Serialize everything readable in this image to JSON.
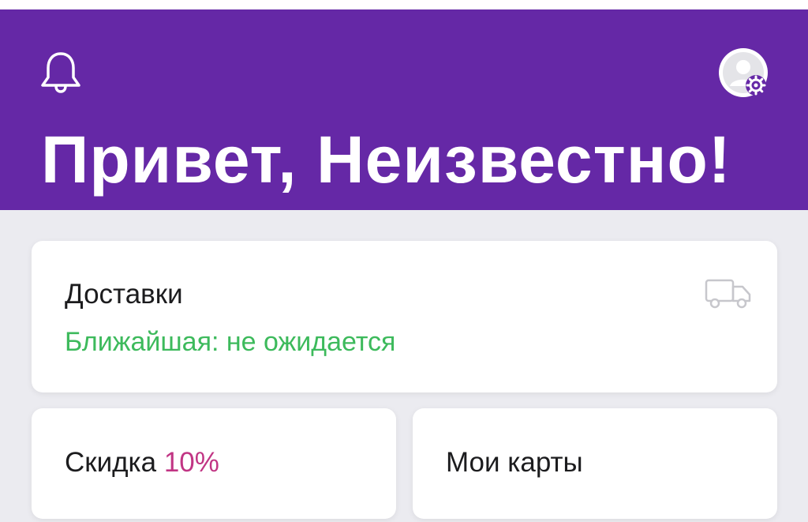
{
  "header": {
    "greeting": "Привет, Неизвестно!",
    "background_color": "#6528a6",
    "notification_icon": "bell-icon",
    "profile_icon": "avatar-settings-icon"
  },
  "deliveries": {
    "title": "Доставки",
    "nearest": "Ближайшая: не ожидается",
    "nearest_color": "#3dba5c",
    "icon": "truck-icon"
  },
  "discount": {
    "label": "Скидка",
    "value": "10%",
    "value_color": "#c13584"
  },
  "my_cards": {
    "label": "Мои карты"
  }
}
